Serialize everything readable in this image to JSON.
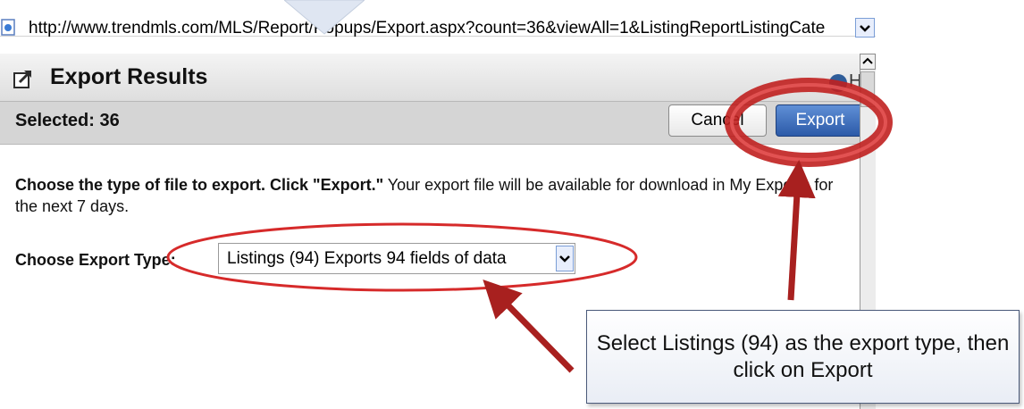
{
  "browser": {
    "url": "http://www.trendmls.com/MLS/Report/Popups/Export.aspx?count=36&viewAll=1&ListingReportListingCate"
  },
  "dialog": {
    "title": "Export Results",
    "help_label": "Help",
    "selected_label": "Selected: 36",
    "cancel_label": "Cancel",
    "export_label": "Export",
    "instructions_bold": "Choose the type of file to export. Click \"Export.\"",
    "instructions_rest": " Your export file will be available for download in My Exports for the next 7 days.",
    "export_type_label": "Choose Export Type:",
    "export_type_selected": "Listings (94) Exports 94 fields of data"
  },
  "annotation": {
    "callout_text": "Select Listings (94) as the export type, then click on Export"
  },
  "colors": {
    "annotation_red": "#c0201f",
    "export_button_blue": "#2c5aa8"
  }
}
